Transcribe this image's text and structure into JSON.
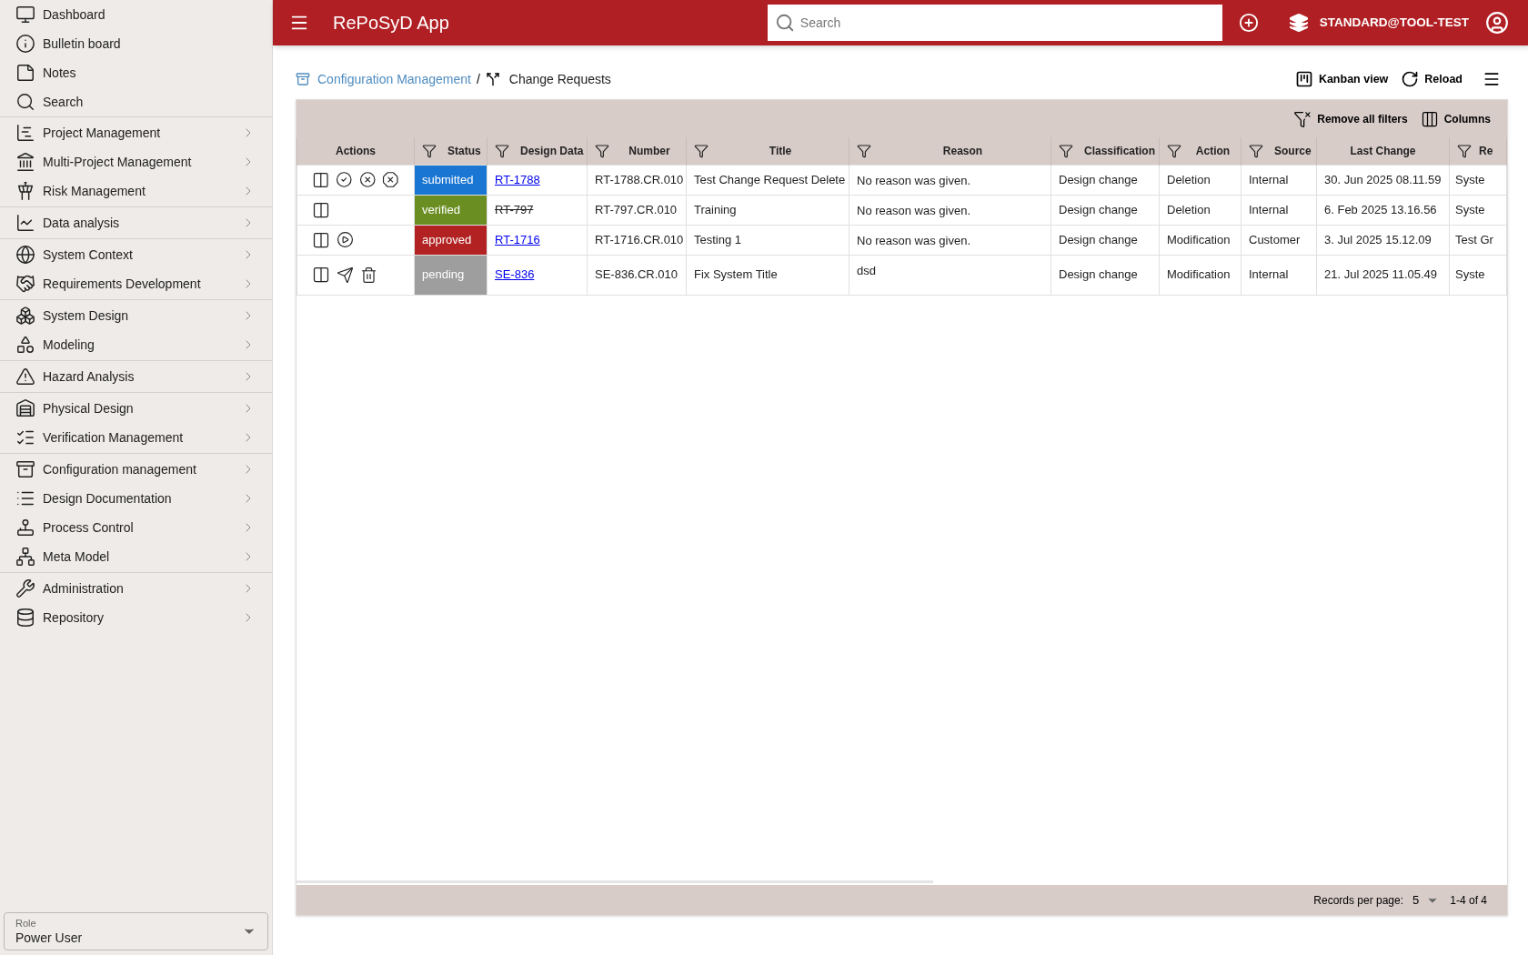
{
  "app": {
    "title": "RePoSyD App"
  },
  "topbar": {
    "search": {
      "placeholder": "Search"
    },
    "user": "STANDARD@TOOL-TEST"
  },
  "sidebar": {
    "groups": [
      [
        {
          "label": "Dashboard",
          "expandable": false
        },
        {
          "label": "Bulletin board",
          "expandable": false
        },
        {
          "label": "Notes",
          "expandable": false
        },
        {
          "label": "Search",
          "expandable": false
        }
      ],
      [
        {
          "label": "Project Management",
          "expandable": true
        },
        {
          "label": "Multi-Project Management",
          "expandable": true
        },
        {
          "label": "Risk Management",
          "expandable": true
        }
      ],
      [
        {
          "label": "Data analysis",
          "expandable": true
        }
      ],
      [
        {
          "label": "System Context",
          "expandable": true
        },
        {
          "label": "Requirements Development",
          "expandable": true
        }
      ],
      [
        {
          "label": "System Design",
          "expandable": true
        },
        {
          "label": "Modeling",
          "expandable": true
        }
      ],
      [
        {
          "label": "Hazard Analysis",
          "expandable": true
        }
      ],
      [
        {
          "label": "Physical Design",
          "expandable": true
        },
        {
          "label": "Verification Management",
          "expandable": true
        }
      ],
      [
        {
          "label": "Configuration management",
          "expandable": true
        },
        {
          "label": "Design Documentation",
          "expandable": true
        },
        {
          "label": "Process Control",
          "expandable": true
        },
        {
          "label": "Meta Model",
          "expandable": true
        }
      ],
      [
        {
          "label": "Administration",
          "expandable": true
        },
        {
          "label": "Repository",
          "expandable": true
        }
      ]
    ],
    "role": {
      "label": "Role",
      "value": "Power User"
    }
  },
  "breadcrumb": {
    "separator": "/",
    "items": [
      {
        "label": "Configuration Management",
        "link": true
      },
      {
        "label": "Change Requests",
        "link": false
      }
    ]
  },
  "toolbar": {
    "buttons": [
      "Kanban view",
      "Reload"
    ]
  },
  "table_toolbar": {
    "buttons": [
      "Remove all filters",
      "Columns"
    ]
  },
  "table": {
    "columns": [
      {
        "label": "Actions",
        "filter": false
      },
      {
        "label": "Status",
        "filter": true
      },
      {
        "label": "Design Data",
        "filter": true
      },
      {
        "label": "Number",
        "filter": true
      },
      {
        "label": "Title",
        "filter": true
      },
      {
        "label": "Reason",
        "filter": true
      },
      {
        "label": "Classification",
        "filter": true
      },
      {
        "label": "Action",
        "filter": true
      },
      {
        "label": "Source",
        "filter": true
      },
      {
        "label": "Last Change",
        "filter": false
      },
      {
        "label": "Re",
        "filter": true
      }
    ],
    "rows": [
      {
        "actions": [
          {
            "kind": "compare"
          },
          {
            "kind": "accept"
          },
          {
            "kind": "reject"
          },
          {
            "kind": "stop"
          }
        ],
        "status": {
          "label": "submitted",
          "color": "#1976d2"
        },
        "design_data": {
          "label": "RT-1788",
          "deleted": false
        },
        "number": "RT-1788.CR.010",
        "title": "Test Change Request Delete",
        "reason": "No reason was given.",
        "classification": "Design change",
        "action": "Deletion",
        "source": "Internal",
        "last_change": "30. Jun 2025 08.11.59",
        "column_11": "Syste"
      },
      {
        "actions": [
          {
            "kind": "compare"
          }
        ],
        "status": {
          "label": "verified",
          "color": "#6b8e23"
        },
        "design_data": {
          "label": "RT-797",
          "deleted": true
        },
        "number": "RT-797.CR.010",
        "title": "Training",
        "reason": "No reason was given.",
        "classification": "Design change",
        "action": "Deletion",
        "source": "Internal",
        "last_change": "6. Feb 2025 13.16.56",
        "column_11": "Syste"
      },
      {
        "actions": [
          {
            "kind": "compare"
          },
          {
            "kind": "start"
          }
        ],
        "status": {
          "label": "approved",
          "color": "#b22222"
        },
        "design_data": {
          "label": "RT-1716",
          "deleted": false
        },
        "number": "RT-1716.CR.010",
        "title": "Testing 1",
        "reason": "No reason was given.",
        "classification": "Design change",
        "action": "Modification",
        "source": "Customer",
        "last_change": "3. Jul 2025 15.12.09",
        "column_11": "Test Gr"
      },
      {
        "actions": [
          {
            "kind": "compare"
          },
          {
            "kind": "send"
          },
          {
            "kind": "delete"
          }
        ],
        "status": {
          "label": "pending",
          "color": "#9e9e9e"
        },
        "design_data": {
          "label": "SE-836",
          "deleted": false
        },
        "number": "SE-836.CR.010",
        "title": "Fix System Title",
        "reason": "dsd",
        "classification": "Design change",
        "action": "Modification",
        "source": "Internal",
        "last_change": "21. Jul 2025 11.05.49",
        "column_11": "Syste"
      }
    ]
  },
  "pagination": {
    "label": "Records per page:",
    "value": "5",
    "range": "1-4 of 4"
  }
}
